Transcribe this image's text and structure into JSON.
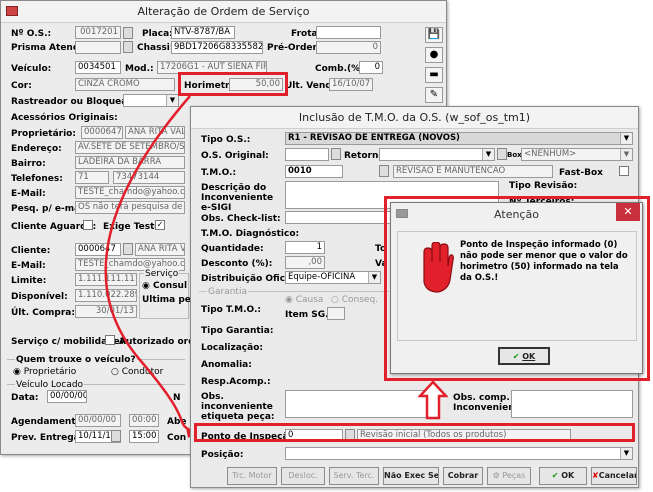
{
  "os_window": {
    "title": "Alteração de Ordem de Serviço",
    "no_os_label": "Nº O.S.:",
    "no_os": "0017201",
    "prisma_label": "Prisma Atend.:",
    "placa_label": "Placa:",
    "placa": "NTV-8787/BA",
    "chassi_label": "Chassi:",
    "chassi": "9BD17206G83355825",
    "frota_label": "Frota:",
    "pre_ordem_label": "Pré-Ordem:",
    "pre_ordem": "0",
    "veiculo_label": "Veículo:",
    "veiculo": "0034501",
    "mod_label": "Mod.:",
    "modelo": "17206G1 - AUT SIENA FIRE FLEX",
    "comb_label": "Comb.(%):",
    "comb": "0",
    "cor_label": "Cor:",
    "cor": "CINZA CROMO",
    "horimetro_label": "Horimetro:",
    "horimetro": "50,00",
    "ult_venda_label": "Ult. Venda:",
    "ult_venda": "16/10/07",
    "rastreador_label": "Rastreador ou Bloqueador:",
    "acessorios_label": "Acessórios Originais:",
    "proprietario_label": "Proprietário:",
    "proprietario_cod": "0000647",
    "proprietario_nome": "ANA RITA VALVE",
    "endereco_label": "Endereço:",
    "endereco": "AV.SETE DE SETEMBRO/SIMONSI",
    "bairro_label": "Bairro:",
    "bairro": "LADEIRA DA BARRA",
    "telefones_label": "Telefones:",
    "tel_ddd": "71",
    "tel_num": "73473144",
    "email_label": "E-Mail:",
    "email": "TESTE_chamdo@yahoo.com.br",
    "pesq_label": "Pesq. p/ e-mail:",
    "pesq": "OS não terá pesquisa de S",
    "cliente_aguarda_label": "Cliente Aguarda:",
    "exige_teste_label": "Exige Teste:",
    "cliente_label": "Cliente:",
    "cliente_cod": "0000647",
    "cliente_nome": "ANA RITA VA",
    "email2_label": "E-Mail:",
    "email2": "TESTE_chamdo@yahoo.com",
    "limite_label": "Limite:",
    "limite": "1.111.111.111,",
    "disponivel_label": "Disponível:",
    "disponivel": "1.110.022.289",
    "ult_compra_label": "Últ. Compra:",
    "ult_compra": "30/01/13",
    "servico_group": "Serviço",
    "consul_label": "Consul",
    "ultima_pes_label": "Ultima pes",
    "servico_mob_label": "Serviço c/ mobilidade?",
    "autorizado_label": "Autorizado orça",
    "quem_trouxe_label": "Quem trouxe o veículo?",
    "proprietario_radio": "Proprietário",
    "condutor_radio": "Condutor",
    "veiculo_locado_label": "Veículo Locado",
    "data_label": "Data:",
    "data_locado": "00/00/00",
    "n_label": "N",
    "agendamento_label": "Agendamento:",
    "agend_data": "00/00/00",
    "agend_hora": "00:00",
    "abe_label": "Abe",
    "prev_entrega_label": "Prev. Entrega:",
    "prev_data": "10/11/16",
    "prev_hora": "15:00",
    "con_label": "Con"
  },
  "tmo_window": {
    "title": "Inclusão de T.M.O. da O.S. (w_sof_os_tm1)",
    "tipo_os_label": "Tipo O.S.:",
    "tipo_os": "R1 - REVISAO DE ENTREGA (NOVOS)",
    "os_original_label": "O.S. Original:",
    "retorno_label": "Retorno:",
    "box_label": "Box:",
    "box": "<NENHUM>",
    "tmo_label": "T.M.O.:",
    "tmo_code": "0010",
    "tmo_desc": "REVISAO E MANUTENCAO",
    "fast_box_label": "Fast-Box",
    "descricao_label": "Descrição do Inconveniente e-SIGI",
    "tipo_revisao_label": "Tipo Revisão:",
    "n_terceiros_label": "Nº Terceiros:",
    "obs_checklist_label": "Obs. Check-list:",
    "tmo_diag_label": "T.M.O. Diagnóstico:",
    "quantidade_label": "Quantidade:",
    "quantidade": "1",
    "to_label": "To",
    "desconto_label": "Desconto (%):",
    "desconto": ",00",
    "va_label": "Va",
    "distribuicao_label": "Distribuição Oficina:",
    "distribuicao": "Equipe-OFICINA",
    "garantia_group": "Garantia",
    "causa_label": "Causa",
    "conseq_label": "Conseq.",
    "tipo_tmo_label": "Tipo T.M.O.:",
    "item_sg_label": "Item SG.:",
    "tipo_garantia_label": "Tipo Garantia:",
    "localizacao_label": "Localização:",
    "anomalia_label": "Anomalia:",
    "resp_acomp_label": "Resp.Acomp.:",
    "obs_etiqueta_label": "Obs. inconveniente etiqueta peça:",
    "obs_comp_label": "Obs. comp. Inconveniente:",
    "ponto_inspecao_label": "Ponto de Inspeção:",
    "ponto_inspecao": "0",
    "ponto_desc": "Revisão inicial (Todos os produtos)",
    "posicao_label": "Posição:",
    "btn_trc_motor": "Trc. Motor",
    "btn_desloc": "Desloc.",
    "btn_serv_terc": "Serv. Terc.",
    "btn_nao_exec": "Não Exec Serv",
    "btn_cobrar": "Cobrar",
    "btn_pecas": "Peças",
    "btn_ok": "OK",
    "btn_cancelar": "Cancelar"
  },
  "alert": {
    "title": "Atenção",
    "message": "Ponto de Inspeção informado (0) não pode ser menor que o valor do horimetro (50) informado na tela da O.S.!",
    "ok": "OK"
  },
  "colors": {
    "highlight": "#e2202c",
    "alert_title": "#ffffff"
  }
}
